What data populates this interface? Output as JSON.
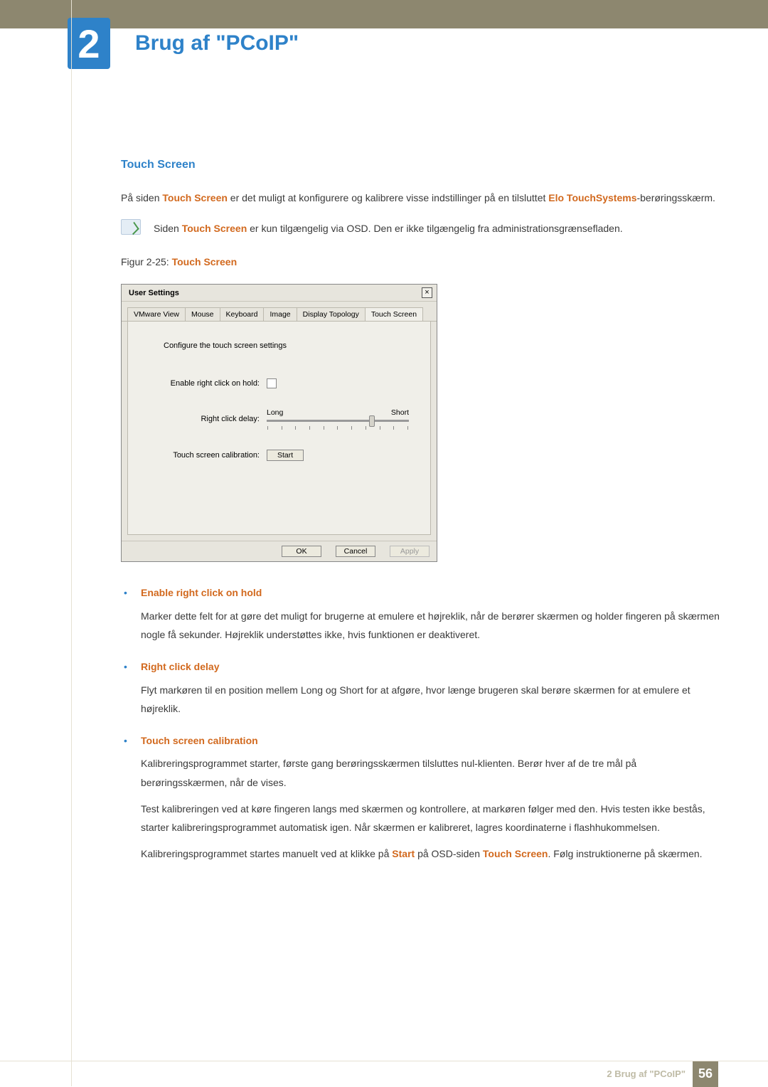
{
  "chapter": {
    "number": "2",
    "title": "Brug af \"PCoIP\""
  },
  "section": {
    "heading": "Touch Screen"
  },
  "intro": {
    "p1_a": "På siden ",
    "p1_b": "Touch Screen",
    "p1_c": " er det muligt at konfigurere og kalibrere visse indstillinger på en tilsluttet ",
    "p1_d": "Elo TouchSystems",
    "p1_e": "-berøringsskærm."
  },
  "note": {
    "a": "Siden ",
    "b": "Touch Screen",
    "c": " er kun tilgængelig via OSD. Den er ikke tilgængelig fra administrationsgrænsefladen."
  },
  "figure": {
    "label_a": "Figur 2-25: ",
    "label_b": "Touch Screen"
  },
  "dialog": {
    "title": "User Settings",
    "close": "×",
    "tabs": [
      "VMware View",
      "Mouse",
      "Keyboard",
      "Image",
      "Display Topology",
      "Touch Screen"
    ],
    "desc": "Configure the touch screen settings",
    "labels": {
      "enable": "Enable right click on hold:",
      "delay": "Right click delay:",
      "calibration": "Touch screen calibration:"
    },
    "slider": {
      "long": "Long",
      "short": "Short",
      "value_pct": 72
    },
    "start": "Start",
    "buttons": {
      "ok": "OK",
      "cancel": "Cancel",
      "apply": "Apply"
    }
  },
  "list": {
    "enable": {
      "title": "Enable right click on hold",
      "body": "Marker dette felt for at gøre det muligt for brugerne at emulere et højreklik, når de berører skærmen og holder fingeren på skærmen nogle få sekunder. Højreklik understøttes ikke, hvis funktionen er deaktiveret."
    },
    "delay": {
      "title": "Right click delay",
      "body": "Flyt markøren til en position mellem Long og Short for at afgøre, hvor længe brugeren skal berøre skærmen for at emulere et højreklik."
    },
    "calibration": {
      "title": "Touch screen calibration",
      "p1": "Kalibreringsprogrammet starter, første gang berøringsskærmen tilsluttes nul-klienten. Berør hver af de tre mål på berøringsskærmen, når de vises.",
      "p2": "Test kalibreringen ved at køre fingeren langs med skærmen og kontrollere, at markøren følger med den. Hvis testen ikke bestås, starter kalibreringsprogrammet automatisk igen. Når skærmen er kalibreret, lagres koordinaterne i flashhukommelsen.",
      "p3_a": "Kalibreringsprogrammet startes manuelt ved at klikke på ",
      "p3_b": "Start",
      "p3_c": " på OSD-siden ",
      "p3_d": "Touch Screen",
      "p3_e": ". Følg instruktionerne på skærmen."
    }
  },
  "footer": {
    "text": "2 Brug af \"PCoIP\"",
    "page": "56"
  }
}
